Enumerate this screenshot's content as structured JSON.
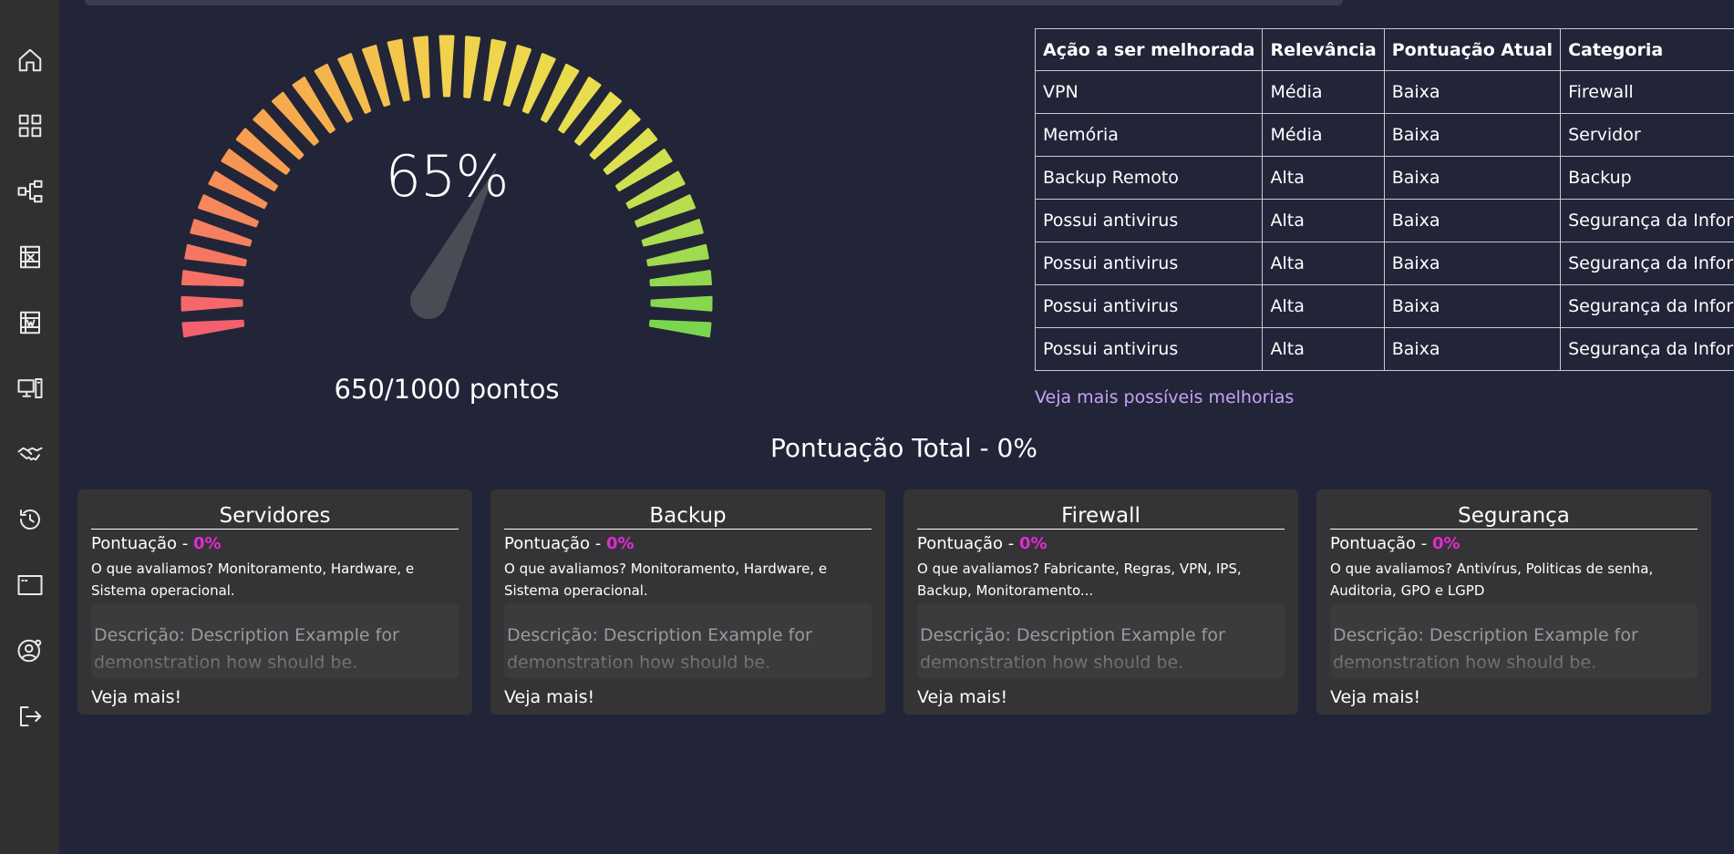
{
  "sidebar": {
    "items": [
      {
        "icon": "home-icon"
      },
      {
        "icon": "dashboard-grid-icon"
      },
      {
        "icon": "network-icon"
      },
      {
        "icon": "excel-icon"
      },
      {
        "icon": "word-icon"
      },
      {
        "icon": "devices-icon"
      },
      {
        "icon": "handshake-icon"
      },
      {
        "icon": "history-icon"
      },
      {
        "icon": "browser-window-icon"
      },
      {
        "icon": "user-settings-icon"
      },
      {
        "icon": "logout-icon"
      }
    ]
  },
  "gauge": {
    "percent_label": "65%",
    "value": 65,
    "points_label": "650/1000 pontos",
    "colors": [
      "#f4606e",
      "#f7a24e",
      "#f2d14d",
      "#e3e24f",
      "#7bd64f"
    ]
  },
  "improvements": {
    "headers": [
      "Ação a ser melhorada",
      "Relevância",
      "Pontuação Atual",
      "Categoria"
    ],
    "rows": [
      [
        "VPN",
        "Média",
        "Baixa",
        "Firewall"
      ],
      [
        "Memória",
        "Média",
        "Baixa",
        "Servidor"
      ],
      [
        "Backup Remoto",
        "Alta",
        "Baixa",
        "Backup"
      ],
      [
        "Possui antivirus",
        "Alta",
        "Baixa",
        "Segurança da Informação"
      ],
      [
        "Possui antivirus",
        "Alta",
        "Baixa",
        "Segurança da Informação"
      ],
      [
        "Possui antivirus",
        "Alta",
        "Baixa",
        "Segurança da Informação"
      ],
      [
        "Possui antivirus",
        "Alta",
        "Baixa",
        "Segurança da Informação"
      ]
    ],
    "more_link": "Veja mais possíveis melhorias"
  },
  "total": {
    "title": "Pontuação Total - 0%"
  },
  "cards": [
    {
      "title": "Servidores",
      "score_label": "Pontuação - ",
      "score_value": "0%",
      "evaluates": "O que avaliamos? Monitoramento, Hardware, e Sistema operacional.",
      "description": "Descrição: Description Example for demonstration how should be.",
      "more": "Veja mais!"
    },
    {
      "title": "Backup",
      "score_label": "Pontuação - ",
      "score_value": "0%",
      "evaluates": "O que avaliamos? Monitoramento, Hardware, e Sistema operacional.",
      "description": "Descrição: Description Example for demonstration how should be.",
      "more": "Veja mais!"
    },
    {
      "title": "Firewall",
      "score_label": "Pontuação - ",
      "score_value": "0%",
      "evaluates": "O que avaliamos? Fabricante, Regras, VPN, IPS, Backup, Monitoramento...",
      "description": "Descrição: Description Example for demonstration how should be.",
      "more": "Veja mais!"
    },
    {
      "title": "Segurança",
      "score_label": "Pontuação - ",
      "score_value": "0%",
      "evaluates": "O que avaliamos? Antivírus, Politicas de senha, Auditoria, GPO e LGPD",
      "description": "Descrição: Description Example for demonstration how should be.",
      "more": "Veja mais!"
    }
  ]
}
